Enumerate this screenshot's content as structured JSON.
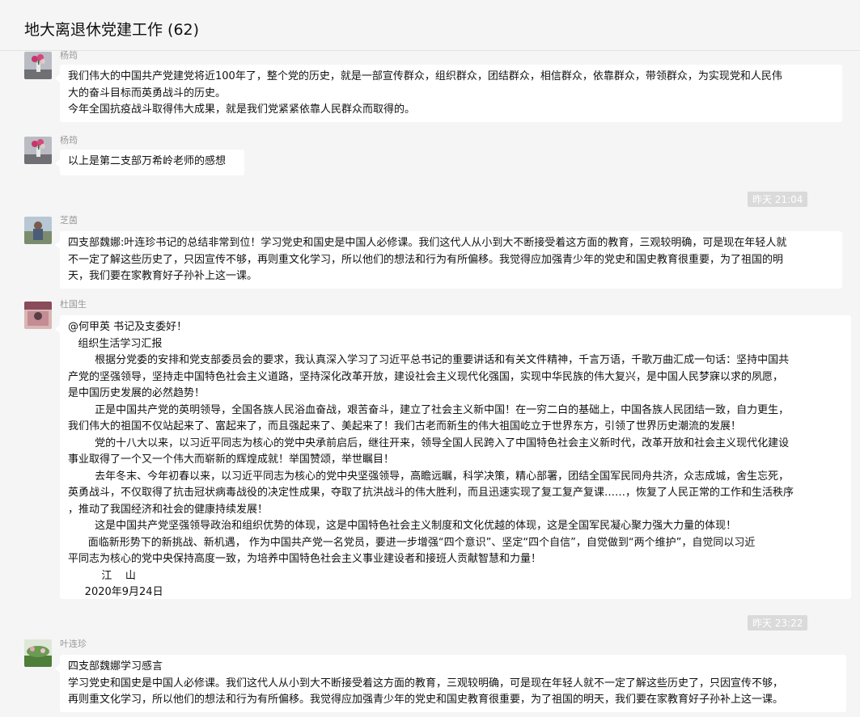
{
  "chat": {
    "title": "地大离退休党建工作 (62)"
  },
  "messages": [
    {
      "sender": "杨筠",
      "lines": [
        "我们伟大的中国共产党建党将近100年了，整个党的历史，就是一部宣传群众，组织群众，团结群众，相信群众，依靠群众，带领群众，为实现党和人民伟",
        "大的奋斗目标而英勇战斗的历史。",
        "今年全国抗疫战斗取得伟大成果，就是我们党紧紧依靠人民群众而取得的。"
      ]
    },
    {
      "sender": "杨筠",
      "lines": [
        "以上是第二支部万希岭老师的感想"
      ]
    },
    {
      "sender": "芝茵",
      "lines": [
        "四支部魏娜:叶连珍书记的总结非常到位！学习党史和国史是中国人必修课。我们这代人从小到大不断接受着这方面的教育，三观较明确，可是现在年轻人就",
        "不一定了解这些历史了，只因宣传不够，再则重文化学习，所以他们的想法和行为有所偏移。我觉得应加强青少年的党史和国史教育很重要，为了祖国的明",
        "天，我们要在家教育好子孙补上这一课。"
      ]
    },
    {
      "sender": "杜国生",
      "lines": [
        "@何甲英 书记及支委好！",
        "   组织生活学习汇报",
        "        根据分党委的安排和党支部委员会的要求，我认真深入学习了习近平总书记的重要讲话和有关文件精神，千言万语，千歌万曲汇成一句话：坚持中国共",
        "产党的坚强领导，坚持走中国特色社会主义道路，坚持深化改革开放，建设社会主义现代化强国，实现中华民族的伟大复兴，是中国人民梦寐以求的夙愿，",
        "是中国历史发展的必然趋势！",
        "        正是中国共产党的英明领导，全国各族人民浴血奋战，艰苦奋斗，建立了社会主义新中国！在一穷二白的基础上，中国各族人民团结一致，自力更生，",
        "我们伟大的祖国不仅站起来了、富起来了，而且强起来了、美起来了！我们古老而新生的伟大祖国屹立于世界东方，引领了世界历史潮流的发展！",
        "        党的十八大以来，以习近平同志为核心的党中央承前启后，继往开来，领导全国人民跨入了中国特色社会主义新时代，改革开放和社会主义现代化建设",
        "事业取得了一个又一个伟大而崭新的辉煌成就！举国赞颂，举世瞩目！",
        "        去年冬末、今年初春以来，以习近平同志为核心的党中央坚强领导，高瞻远瞩，科学决策，精心部署，团结全国军民同舟共济，众志成城，舍生忘死，",
        "英勇战斗，不仅取得了抗击冠状病毒战役的决定性成果，夺取了抗洪战斗的伟大胜利，而且迅速实现了复工复产复课……，恢复了人民正常的工作和生活秩序",
        "，推动了我国经济和社会的健康持续发展！",
        "        这是中国共产党坚强领导政治和组织优势的体现，这是中国特色社会主义制度和文化优越的体现，这是全国军民凝心聚力强大力量的体现！",
        "      面临新形势下的新挑战、新机遇， 作为中国共产党一名党员，要进一步增强“四个意识”、坚定“四个自信”，自觉做到“两个维护”，自觉同以习近",
        "平同志为核心的党中央保持高度一致，为培养中国特色社会主义事业建设者和接班人贡献智慧和力量！",
        "          江    山",
        "     2020年9月24日"
      ]
    },
    {
      "sender": "叶连珍",
      "lines": [
        "四支部魏娜学习感言",
        "学习党史和国史是中国人必修课。我们这代人从小到大不断接受着这方面的教育，三观较明确，可是现在年轻人就不一定了解这些历史了，只因宣传不够，",
        "再则重文化学习，所以他们的想法和行为有所偏移。我觉得应加强青少年的党史和国史教育很重要，为了祖国的明天，我们要在家教育好子孙补上这一课。"
      ]
    }
  ],
  "timestamps": [
    "昨天 21:04",
    "昨天 23:22"
  ]
}
